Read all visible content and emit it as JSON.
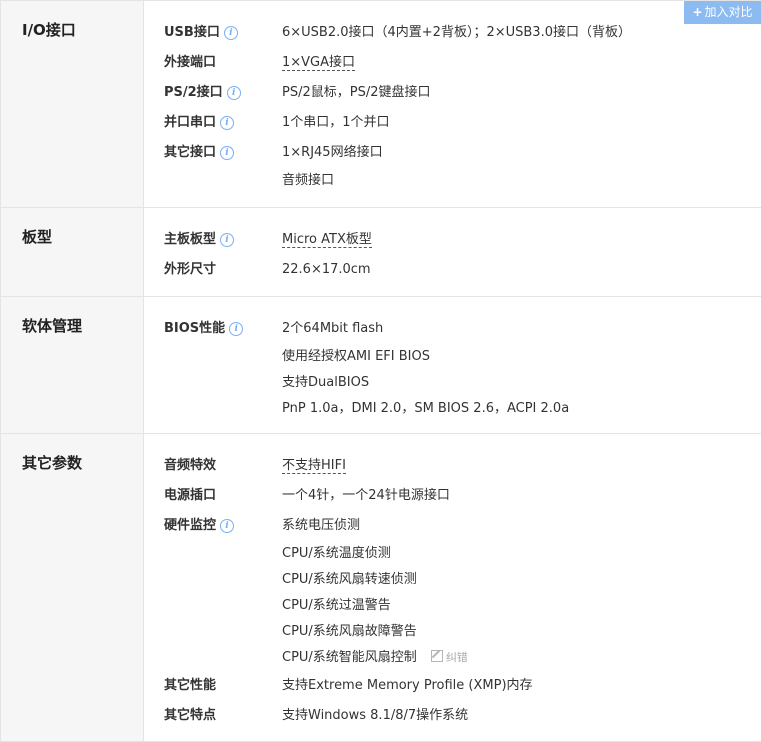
{
  "compare_button": {
    "label": "加入对比"
  },
  "correct_link": {
    "label": "纠错"
  },
  "sections": {
    "io": {
      "title": "I/O接口",
      "usb": {
        "label": "USB接口",
        "values": [
          "6×USB2.0接口（4内置+2背板）；2×USB3.0接口（背板）"
        ]
      },
      "external": {
        "label": "外接端口",
        "values": [
          "1×VGA接口"
        ]
      },
      "ps2": {
        "label": "PS/2接口",
        "values": [
          "PS/2鼠标，PS/2键盘接口"
        ]
      },
      "parallel_serial": {
        "label": "并口串口",
        "values": [
          "1个串口，1个并口"
        ]
      },
      "other": {
        "label": "其它接口",
        "values": [
          "1×RJ45网络接口",
          "音频接口"
        ]
      }
    },
    "board": {
      "title": "板型",
      "form": {
        "label": "主板板型",
        "values": [
          "Micro ATX板型"
        ]
      },
      "size": {
        "label": "外形尺寸",
        "values": [
          "22.6×17.0cm"
        ]
      }
    },
    "software": {
      "title": "软体管理",
      "bios": {
        "label": "BIOS性能",
        "values": [
          "2个64Mbit flash",
          "使用经授权AMI EFI BIOS",
          "支持DualBIOS",
          "PnP 1.0a，DMI 2.0，SM BIOS 2.6，ACPI 2.0a"
        ]
      }
    },
    "other": {
      "title": "其它参数",
      "audio": {
        "label": "音频特效",
        "values": [
          "不支持HIFI"
        ]
      },
      "power": {
        "label": "电源插口",
        "values": [
          "一个4针，一个24针电源接口"
        ]
      },
      "monitor": {
        "label": "硬件监控",
        "values": [
          "系统电压侦测",
          "CPU/系统温度侦测",
          "CPU/系统风扇转速侦测",
          "CPU/系统过温警告",
          "CPU/系统风扇故障警告",
          "CPU/系统智能风扇控制"
        ]
      },
      "perf": {
        "label": "其它性能",
        "values": [
          "支持Extreme Memory Profile (XMP)内存"
        ]
      },
      "features": {
        "label": "其它特点",
        "values": [
          "支持Windows 8.1/8/7操作系统"
        ]
      }
    }
  }
}
